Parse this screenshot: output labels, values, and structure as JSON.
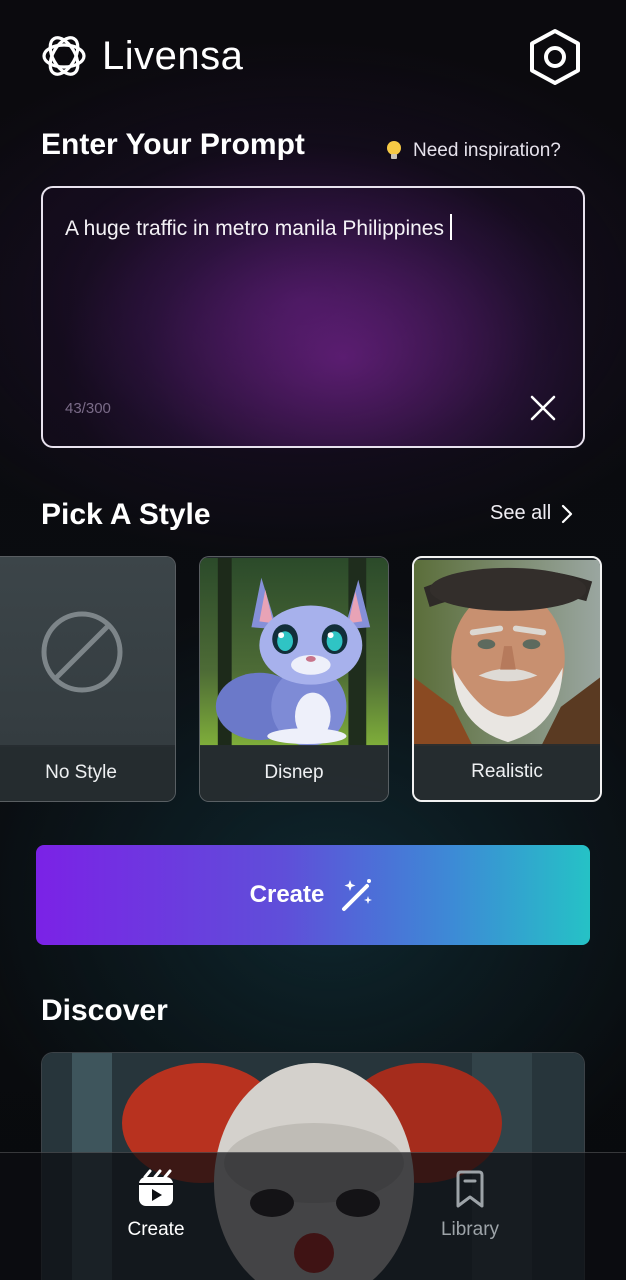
{
  "header": {
    "app_name": "Livensa",
    "logo_icon": "livensa-logo-icon",
    "settings_icon": "hexagon-settings-icon"
  },
  "prompt": {
    "title": "Enter Your Prompt",
    "inspiration_label": "Need inspiration?",
    "value": "A huge traffic in metro manila Philippines",
    "char_count": "43/300"
  },
  "styles": {
    "title": "Pick A Style",
    "see_all_label": "See all",
    "items": [
      {
        "label": "No Style",
        "icon": "no-style-icon"
      },
      {
        "label": "Disnep"
      },
      {
        "label": "Realistic",
        "selected": true
      }
    ]
  },
  "create": {
    "label": "Create",
    "icon": "magic-wand-icon"
  },
  "discover": {
    "title": "Discover"
  },
  "nav": {
    "items": [
      {
        "label": "Create",
        "icon": "create-reel-icon",
        "active": true
      },
      {
        "label": "Library",
        "icon": "bookmark-icon",
        "active": false
      }
    ]
  },
  "colors": {
    "accent_start": "#7b22e6",
    "accent_end": "#25c2c6",
    "background": "#0a0b0f"
  }
}
